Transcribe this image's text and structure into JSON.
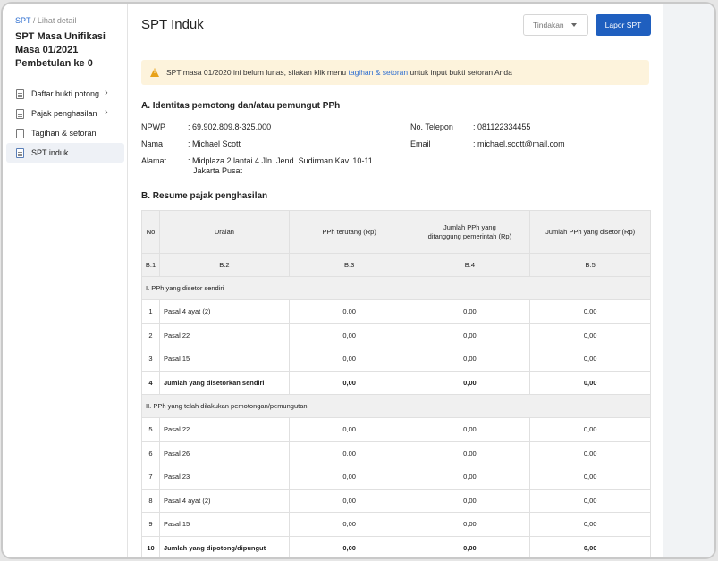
{
  "breadcrumb": {
    "parent": "SPT",
    "separator": " / ",
    "current": "Lihat detail"
  },
  "sidebar": {
    "title_line1": "SPT Masa Unifikasi",
    "title_line2": "Masa 01/2021",
    "title_line3": "Pembetulan ke 0",
    "items": [
      {
        "label": "Daftar bukti potong",
        "icon": "document-icon",
        "has_chevron": true
      },
      {
        "label": "Pajak penghasilan",
        "icon": "document-icon",
        "has_chevron": true
      },
      {
        "label": "Tagihan & setoran",
        "icon": "receipt-icon",
        "has_chevron": false
      },
      {
        "label": "SPT induk",
        "icon": "document-icon",
        "has_chevron": false,
        "active": true
      }
    ],
    "chevron": "›"
  },
  "header": {
    "title": "SPT Induk",
    "action_label": "Tindakan",
    "primary_label": "Lapor SPT"
  },
  "alert": {
    "text_before": "SPT masa 01/2020 ini belum lunas, silakan klik menu ",
    "link": "tagihan & setoran",
    "text_after": " untuk input bukti setoran Anda",
    "icon_glyph": "!"
  },
  "section_a": {
    "title": "A. Identitas pemotong dan/atau pemungut PPh",
    "npwp_label": "NPWP",
    "npwp_value": ": 69.902.809.8-325.000",
    "nama_label": "Nama",
    "nama_value": ": Michael Scott",
    "alamat_label": "Alamat",
    "alamat_value_line1": ": Midplaza 2 lantai 4 Jln. Jend. Sudirman Kav. 10-11",
    "alamat_value_line2": "Jakarta Pusat",
    "telp_label": "No. Telepon",
    "telp_value": ": 081122334455",
    "email_label": "Email",
    "email_value": ": michael.scott@mail.com"
  },
  "section_b": {
    "title": "B. Resume pajak penghasilan",
    "headers": {
      "no": "No",
      "uraian": "Uraian",
      "pph_terutang": "PPh terutang (Rp)",
      "ditanggung_l1": "Jumlah PPh yang",
      "ditanggung_l2": "ditanggung pemerintah (Rp)",
      "disetor": "Jumlah PPh yang disetor (Rp)"
    },
    "codes": [
      "B.1",
      "B.2",
      "B.3",
      "B.4",
      "B.5"
    ],
    "group1": "I. PPh yang disetor sendiri",
    "group1_rows": [
      {
        "no": "1",
        "uraian": "Pasal 4 ayat (2)",
        "v1": "0,00",
        "v2": "0,00",
        "v3": "0,00"
      },
      {
        "no": "2",
        "uraian": "Pasal 22",
        "v1": "0,00",
        "v2": "0,00",
        "v3": "0,00"
      },
      {
        "no": "3",
        "uraian": "Pasal 15",
        "v1": "0,00",
        "v2": "0,00",
        "v3": "0,00"
      },
      {
        "no": "4",
        "uraian": "Jumlah yang disetorkan sendiri",
        "v1": "0,00",
        "v2": "0,00",
        "v3": "0,00",
        "bold": true
      }
    ],
    "group2": "II. PPh yang telah dilakukan pemotongan/pemungutan",
    "group2_rows": [
      {
        "no": "5",
        "uraian": "Pasal 22",
        "v1": "0,00",
        "v2": "0,00",
        "v3": "0,00"
      },
      {
        "no": "6",
        "uraian": "Pasal 26",
        "v1": "0,00",
        "v2": "0,00",
        "v3": "0,00"
      },
      {
        "no": "7",
        "uraian": "Pasal 23",
        "v1": "0,00",
        "v2": "0,00",
        "v3": "0,00"
      },
      {
        "no": "8",
        "uraian": "Pasal 4 ayat (2)",
        "v1": "0,00",
        "v2": "0,00",
        "v3": "0,00"
      },
      {
        "no": "9",
        "uraian": "Pasal 15",
        "v1": "0,00",
        "v2": "0,00",
        "v3": "0,00"
      },
      {
        "no": "10",
        "uraian": "Jumlah yang dipotong/dipungut",
        "v1": "0,00",
        "v2": "0,00",
        "v3": "0,00",
        "bold": true
      }
    ]
  }
}
